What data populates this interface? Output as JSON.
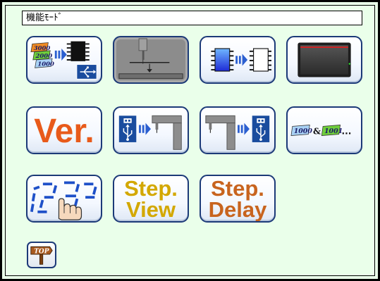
{
  "header": {
    "title": "機能ﾓｰﾄﾞ"
  },
  "buttons": {
    "data_copy": {
      "label_1": "3000",
      "label_2": "2000",
      "label_3": "1000"
    },
    "version": {
      "label": "Ver."
    },
    "pattern_compare": {
      "label_1": "1000",
      "label_2": "&",
      "label_3": "1001",
      "label_4": "..."
    },
    "step_view": {
      "line1": "Step.",
      "line2": "View"
    },
    "step_delay": {
      "line1": "Step.",
      "line2": "Delay"
    }
  },
  "top_button": {
    "label": "TOP"
  },
  "colors": {
    "background": "#eaffea",
    "button_border": "#1c3a78",
    "version_orange": "#e85a1a",
    "step_view_gold": "#d3a800",
    "step_delay_orange": "#c8641e",
    "usb_blue": "#1a4c9e"
  }
}
